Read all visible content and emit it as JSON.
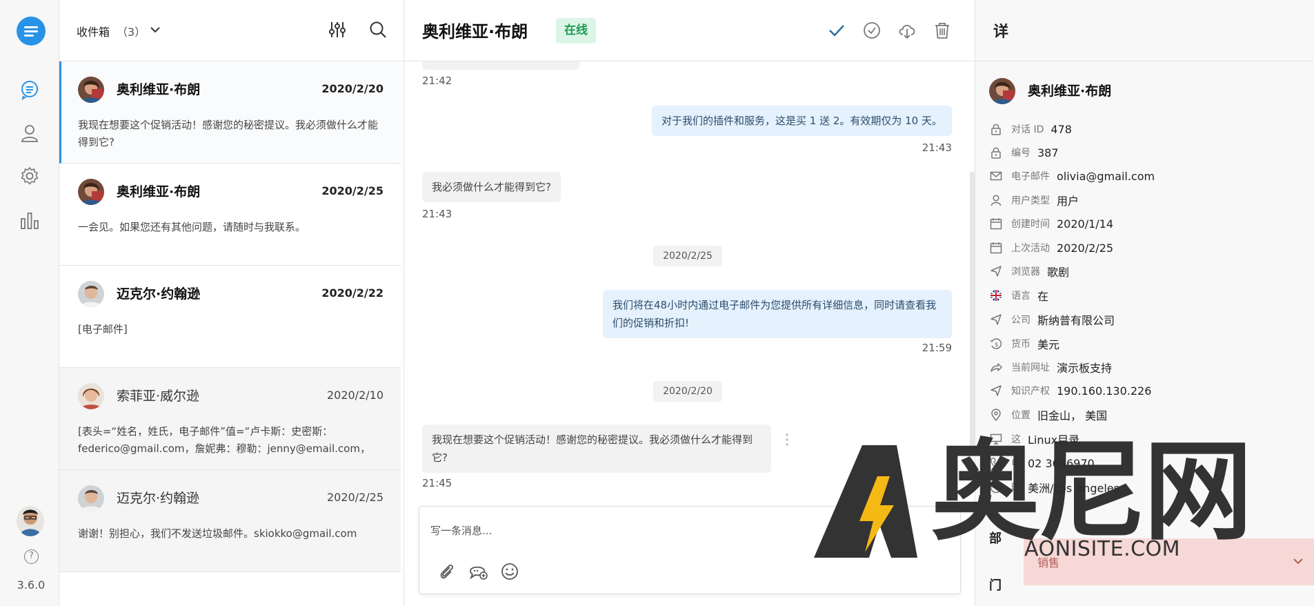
{
  "rail": {
    "version": "3.6.0",
    "help_glyph": "?"
  },
  "list": {
    "inbox_label": "收件箱",
    "inbox_count": "（3）",
    "conversations": [
      {
        "name": "奥利维亚·布朗",
        "date": "2020/2/20",
        "message": "我现在想要这个促销活动！感谢您的秘密提议。我必须做什么才能得到它?"
      },
      {
        "name": "奥利维亚·布朗",
        "date": "2020/2/25",
        "message": "一会见。如果您还有其他问题，请随时与我联系。"
      },
      {
        "name": "迈克尔·约翰逊",
        "date": "2020/2/22",
        "message": "[电子邮件]"
      },
      {
        "name": "索菲亚·威尔逊",
        "date": "2020/2/10",
        "message": "[表头=“姓名，姓氏，电子邮件”值=“卢卡斯：史密斯：federico@gmail.com，詹妮弗：穆勒：jenny@email.com，"
      },
      {
        "name": "迈克尔·约翰逊",
        "date": "2020/2/25",
        "message": "谢谢！别担心，我们不发送垃圾邮件。skiokko@gmail.com"
      }
    ]
  },
  "chat": {
    "title": "奥利维亚·布朗",
    "status": "在线",
    "messages": [
      {
        "time": "21:42"
      },
      {
        "text": "对于我们的插件和服务，这是买 1 送 2。有效期仅为 10 天。",
        "time": "21:43"
      },
      {
        "text": "我必须做什么才能得到它?",
        "time": "21:43"
      },
      {
        "date": "2020/2/25"
      },
      {
        "text": "我们将在48小时内通过电子邮件为您提供所有详细信息，同时请查看我们的促销和折扣!",
        "time": "21:59"
      },
      {
        "date": "2020/2/20"
      },
      {
        "text": "我现在想要这个促销活动！感谢您的秘密提议。我必须做什么才能得到它?",
        "time": "21:45"
      }
    ],
    "composer_placeholder": "写一条消息..."
  },
  "details": {
    "title": "详",
    "name": "奥利维亚·布朗",
    "rows": [
      {
        "label": "对话 ID",
        "value": "478"
      },
      {
        "label": "编号",
        "value": "387"
      },
      {
        "label": "电子邮件",
        "value": "olivia@gmail.com"
      },
      {
        "label": "用户类型",
        "value": "用户"
      },
      {
        "label": "创建时间",
        "value": "2020/1/14"
      },
      {
        "label": "上次活动",
        "value": "2020/2/25"
      },
      {
        "label": "浏览器",
        "value": "歌剧"
      },
      {
        "label": "语言",
        "value": "在"
      },
      {
        "label": "公司",
        "value": "斯纳普有限公司"
      },
      {
        "label": "货币",
        "value": "美元"
      },
      {
        "label": "当前网址",
        "value": "演示板支持"
      },
      {
        "label": "知识产权",
        "value": "190.160.130.226"
      },
      {
        "label": "位置",
        "value": "旧金山， 美国"
      },
      {
        "label": "这",
        "value": "Linux目录"
      },
      {
        "label": "电",
        "value": "02 3666970"
      },
      {
        "label": "时",
        "value": "美洲/Los Angeles"
      }
    ],
    "dept_label_1": "部",
    "dept_label_2": "门",
    "dept_value": "销售"
  },
  "watermark": {
    "text": "奥尼网",
    "url": "AONISITE.COM"
  },
  "colors": {
    "accent": "#2893e6",
    "online_bg": "#dcf5e7",
    "online_text": "#1f9b55",
    "outgoing_bubble": "#e5f1fc",
    "incoming_bubble": "#f2f2f3",
    "dept_select_bg": "#f6d8d6"
  }
}
